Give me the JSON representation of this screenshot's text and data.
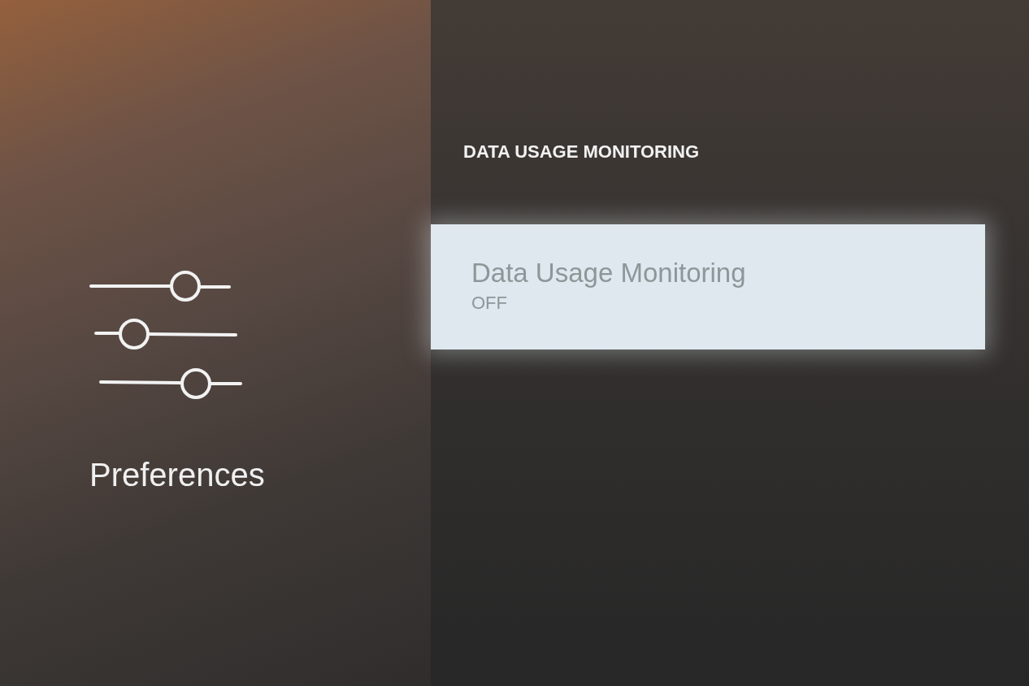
{
  "sidebar": {
    "title": "Preferences"
  },
  "section": {
    "heading": "DATA USAGE MONITORING",
    "items": [
      {
        "label": "Data Usage Monitoring",
        "value": "OFF",
        "selected": true
      }
    ]
  }
}
